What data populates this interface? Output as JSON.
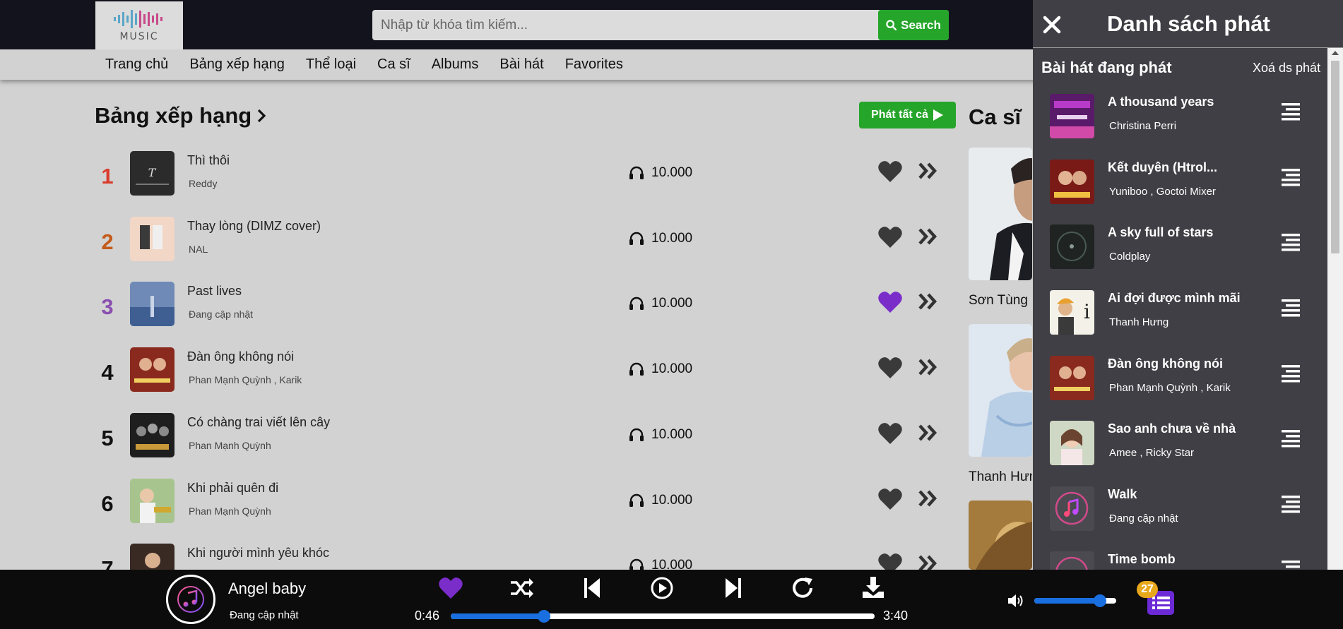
{
  "header": {
    "logo_text": "MUSIC",
    "search": {
      "placeholder": "Nhập từ khóa tìm kiếm...",
      "value": "",
      "button_label": "Search",
      "button_icon": "search-icon",
      "button_color": "#25a52a"
    },
    "nav": [
      "Trang chủ",
      "Bảng xếp hạng",
      "Thể loại",
      "Ca sĩ",
      "Albums",
      "Bài hát",
      "Favorites"
    ]
  },
  "chart": {
    "heading": "Bảng xếp hạng",
    "heading_icon": "chevron-right-icon",
    "play_all_label": "Phát tất cả",
    "rank_colors": [
      "#d93b2c",
      "#c55a1a",
      "#8a4fb0"
    ],
    "liked_color": "#7a2dc9",
    "songs": [
      {
        "rank": "1",
        "title": "Thì thôi",
        "artist": "Reddy",
        "listens": "10.000",
        "liked": false
      },
      {
        "rank": "2",
        "title": "Thay lòng (DIMZ cover)",
        "artist": "NAL",
        "listens": "10.000",
        "liked": false
      },
      {
        "rank": "3",
        "title": "Past lives",
        "artist": "Đang cập nhật",
        "listens": "10.000",
        "liked": true
      },
      {
        "rank": "4",
        "title": "Đàn ông không nói",
        "artist": "Phan Mạnh Quỳnh , Karik",
        "listens": "10.000",
        "liked": false
      },
      {
        "rank": "5",
        "title": "Có chàng trai viết lên cây",
        "artist": "Phan Mạnh Quỳnh",
        "listens": "10.000",
        "liked": false
      },
      {
        "rank": "6",
        "title": "Khi phải quên đi",
        "artist": "Phan Mạnh Quỳnh",
        "listens": "10.000",
        "liked": false
      },
      {
        "rank": "7",
        "title": "Khi người mình yêu khóc",
        "artist": "",
        "listens": "10.000",
        "liked": false
      }
    ]
  },
  "singers": {
    "heading": "Ca sĩ",
    "items": [
      {
        "name": "Sơn Tùng M-TP"
      },
      {
        "name": "Thanh Hưng"
      },
      {
        "name": ""
      }
    ]
  },
  "playlist": {
    "title": "Danh sách phát",
    "now_playing_label": "Bài hát đang phát",
    "clear_label": "Xoá ds phát",
    "background": "#3f3f45",
    "items": [
      {
        "title": "A thousand years",
        "artist": "Christina Perri"
      },
      {
        "title": "Kết duyên (Htrol...",
        "artist": "Yuniboo , Goctoi Mixer"
      },
      {
        "title": "A sky full of stars",
        "artist": "Coldplay"
      },
      {
        "title": "Ai đợi được mình mãi",
        "artist": "Thanh Hưng"
      },
      {
        "title": "Đàn ông không nói",
        "artist": "Phan Mạnh Quỳnh , Karik"
      },
      {
        "title": "Sao anh chưa về nhà",
        "artist": "Amee , Ricky Star"
      },
      {
        "title": "Walk",
        "artist": "Đang cập nhật"
      },
      {
        "title": "Time bomb",
        "artist": ""
      }
    ]
  },
  "player": {
    "title": "Angel baby",
    "artist": "Đang cập nhật",
    "current_time": "0:46",
    "total_time": "3:40",
    "progress": 0.22,
    "volume": 0.8,
    "queue_count": "27",
    "liked": true,
    "accent_color": "#1a6fe0",
    "controls": [
      "heart-icon",
      "shuffle-icon",
      "previous-icon",
      "play-icon",
      "next-icon",
      "repeat-icon",
      "download-icon"
    ]
  }
}
